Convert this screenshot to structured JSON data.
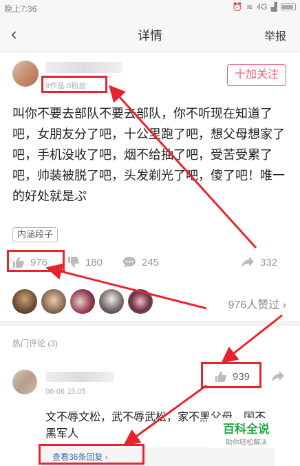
{
  "status_bar": {
    "time": "晚上7:36",
    "network": "4G"
  },
  "nav": {
    "title": "详情",
    "report": "举报"
  },
  "post": {
    "follow_label": "十加关注",
    "author_meta": "9作品 0粉丝",
    "content": "叫你不要去部队不要去部队，你不听现在知道了吧，女朋友分了吧，十公里跑了吧，想父母想家了吧，手机没收了吧，烟不给抽了吧，受苦受累了吧，帅装被脱了吧，头发剃光了吧，傻了吧！唯一的好处就是ぷ",
    "tag": "内涵段子",
    "likes": "976",
    "dislikes": "180",
    "comments": "245",
    "shares": "332",
    "likers_summary": "976人赞过"
  },
  "hot_comments": {
    "header": "热门评论 (3)",
    "items": [
      {
        "date": "06-06 15:05",
        "text": "文不辱文松，武不辱武松，家不黑父母，国不黑军人",
        "likes": "939",
        "replies_label": "查看36条回复 ›"
      }
    ]
  },
  "watermark": {
    "title": "百科全说",
    "subtitle": "助你轻松解决"
  },
  "colors": {
    "accent": "#f05a6e",
    "annotation_red": "#e8232d",
    "watermark_green": "#27a64a"
  }
}
